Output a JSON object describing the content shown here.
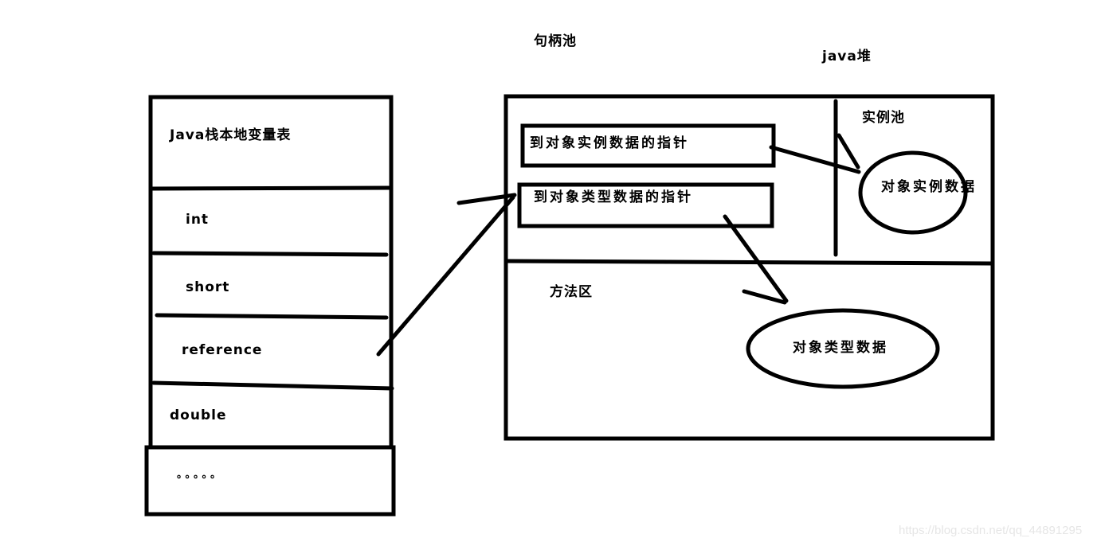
{
  "labels": {
    "handle_pool": "句柄池",
    "java_heap": "java堆",
    "instance_pool": "实例池",
    "method_area": "方法区",
    "instance_data": "对象实例数据",
    "type_data": "对象类型数据",
    "ptr_instance": "到对象实例数据的指针",
    "ptr_type": "到对象类型数据的指针"
  },
  "stack": {
    "title": "Java栈本地变量表",
    "rows": [
      "int",
      "short",
      "reference",
      "double"
    ],
    "ellipsis": "。。。。。"
  },
  "connections": [
    {
      "from": "reference",
      "to": "到对象类型数据的指针"
    },
    {
      "from": "到对象实例数据的指针",
      "to": "对象实例数据"
    },
    {
      "from": "到对象类型数据的指针",
      "to": "对象类型数据"
    }
  ],
  "watermark": "https://blog.csdn.net/qq_44891295"
}
